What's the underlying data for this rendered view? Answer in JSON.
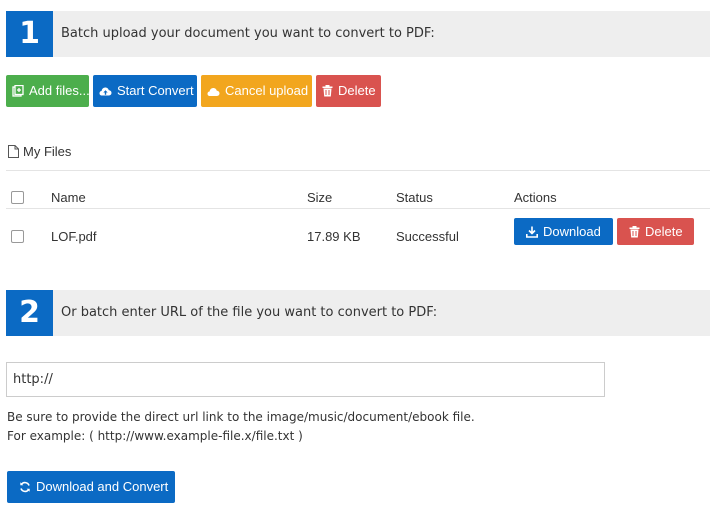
{
  "step1": {
    "number": "1",
    "text": "Batch upload your document you want to convert to PDF:"
  },
  "toolbar": {
    "add_files": "Add files...",
    "start_convert": "Start Convert",
    "cancel_upload": "Cancel upload",
    "delete": "Delete"
  },
  "my_files": {
    "label": "My Files"
  },
  "table": {
    "headers": {
      "name": "Name",
      "size": "Size",
      "status": "Status",
      "actions": "Actions"
    },
    "rows": [
      {
        "name": "LOF.pdf",
        "size": "17.89 KB",
        "status": "Successful",
        "download": "Download",
        "delete": "Delete"
      }
    ]
  },
  "step2": {
    "number": "2",
    "text": "Or batch enter URL of the file you want to convert to PDF:"
  },
  "url_input": {
    "value": "http://"
  },
  "notes": {
    "line1": "Be sure to provide the direct url link to the image/music/document/ebook file.",
    "line2": "For example: ( http://www.example-file.x/file.txt )"
  },
  "convert_button": {
    "label": "Download and Convert"
  },
  "colors": {
    "primary": "#0b6ac4",
    "success": "#4cae4c",
    "warning": "#f2a61e",
    "danger": "#d9534f"
  }
}
